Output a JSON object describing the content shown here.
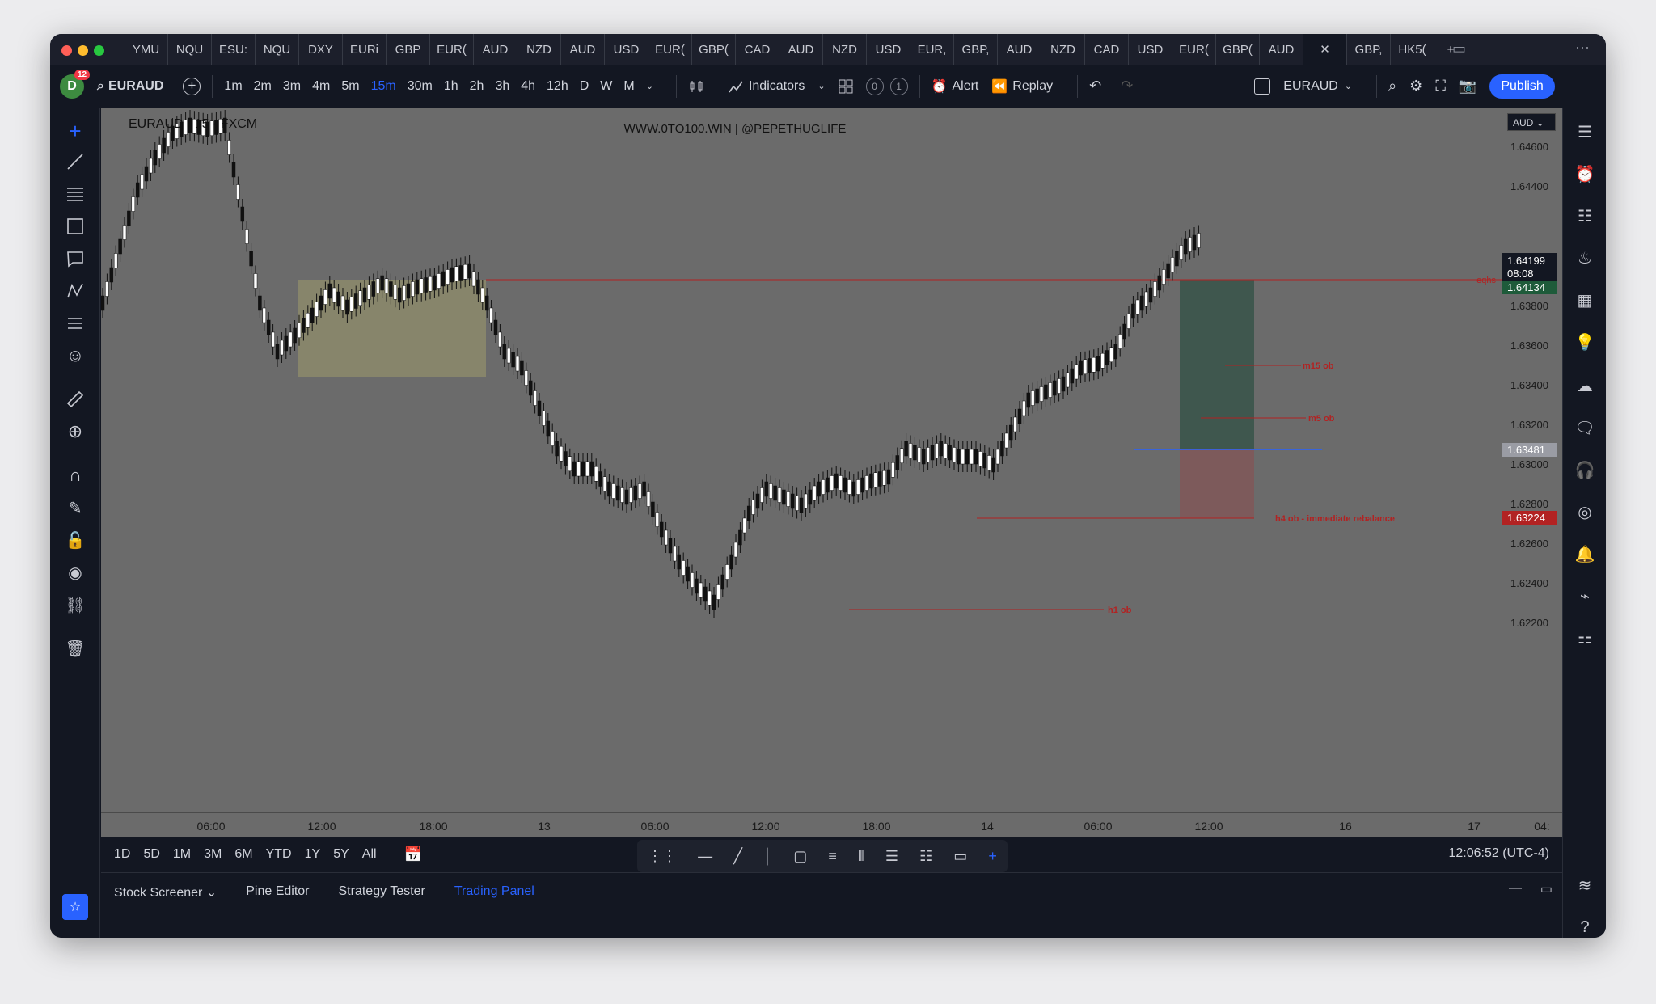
{
  "tabs": [
    "YMU",
    "NQU",
    "ESU:",
    "NQU",
    "DXY",
    "EURi",
    "GBP",
    "EUR(",
    "AUD",
    "NZD",
    "AUD",
    "USD",
    "EUR(",
    "GBP(",
    "CAD",
    "AUD",
    "NZD",
    "USD",
    "EUR,",
    "GBP,",
    "AUD",
    "NZD",
    "CAD",
    "USD",
    "EUR(",
    "GBP(",
    "AUD",
    "",
    "GBP,",
    "HK5("
  ],
  "toolbar": {
    "avatar": "D",
    "notif": "12",
    "symbol": "EURAUD",
    "intervals": [
      "1m",
      "2m",
      "3m",
      "4m",
      "5m",
      "15m",
      "30m",
      "1h",
      "2h",
      "3h",
      "4h",
      "12h",
      "D",
      "W",
      "M"
    ],
    "active_interval": "15m",
    "indicators": "Indicators",
    "c0": "0",
    "c1": "1",
    "alert": "Alert",
    "replay": "Replay",
    "layout_symbol": "EURAUD",
    "publish": "Publish"
  },
  "chart": {
    "legend": "EURAUD · 15 · FXCM",
    "watermark": "WWW.0TO100.WIN  |  @PEPETHUGLIFE",
    "currency": "AUD",
    "labels": {
      "eqhs": "eqhs",
      "m15": "m15 ob",
      "m5": "m5 ob",
      "h4": "h4 ob - immediate rebalance",
      "h1": "h1 ob"
    }
  },
  "chart_data": {
    "type": "candlestick",
    "price_ticks": [
      "1.64600",
      "1.64400",
      "1.64000",
      "1.63800",
      "1.63600",
      "1.63400",
      "1.63200",
      "1.63000",
      "1.62800",
      "1.62600",
      "1.62400",
      "1.62200"
    ],
    "current_price": "1.64199",
    "countdown": "08:08",
    "price_tag2": "1.64134",
    "blue_level": "1.63481",
    "red_level": "1.63224",
    "time_ticks": [
      "06:00",
      "12:00",
      "18:00",
      "13",
      "06:00",
      "12:00",
      "18:00",
      "14",
      "06:00",
      "12:00",
      "16",
      "17",
      "04:"
    ]
  },
  "bottombar": {
    "ranges": [
      "1D",
      "5D",
      "1M",
      "3M",
      "6M",
      "YTD",
      "1Y",
      "5Y",
      "All"
    ],
    "clock": "12:06:52 (UTC-4)"
  },
  "panels": {
    "items": [
      "Stock Screener",
      "Pine Editor",
      "Strategy Tester",
      "Trading Panel"
    ],
    "active": "Trading Panel"
  },
  "colors": {
    "bg": "#131722",
    "chart": "#6b6b6b",
    "accent": "#2962ff",
    "red": "#b22222",
    "green_zone": "#3f574e",
    "red_zone": "#7d5a5b",
    "yellow_zone": "#8e8c6c"
  }
}
